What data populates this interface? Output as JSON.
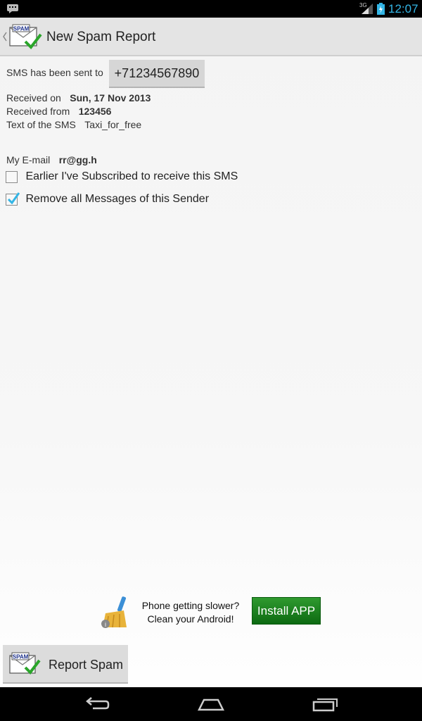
{
  "status_bar": {
    "network": "3G",
    "time": "12:07",
    "icons": [
      "notification-icon",
      "signal-icon",
      "battery-icon"
    ]
  },
  "action_bar": {
    "title": "New Spam Report",
    "logo_text": "SPAM"
  },
  "report": {
    "sent_to_label": "SMS has been sent to",
    "sent_to_number": "+71234567890",
    "received_on_label": "Received on",
    "received_on_value": "Sun, 17 Nov 2013",
    "received_from_label": "Received from",
    "received_from_value": "123456",
    "text_label": "Text of the SMS",
    "text_value": "Taxi_for_free",
    "email_label": "My E-mail",
    "email_value": "rr@gg.h"
  },
  "options": {
    "subscribed_label": "Earlier I've Subscribed to receive this SMS",
    "subscribed_checked": false,
    "remove_all_label": "Remove all Messages of this Sender",
    "remove_all_checked": true
  },
  "ad": {
    "line1": "Phone getting slower?",
    "line2": "Clean your Android!",
    "button_label": "Install APP"
  },
  "report_button": {
    "label": "Report Spam",
    "logo_text": "SPAM"
  },
  "colors": {
    "accent": "#33b5e5",
    "install_green": "#1c7f1f",
    "check_blue": "#33b5e5"
  }
}
